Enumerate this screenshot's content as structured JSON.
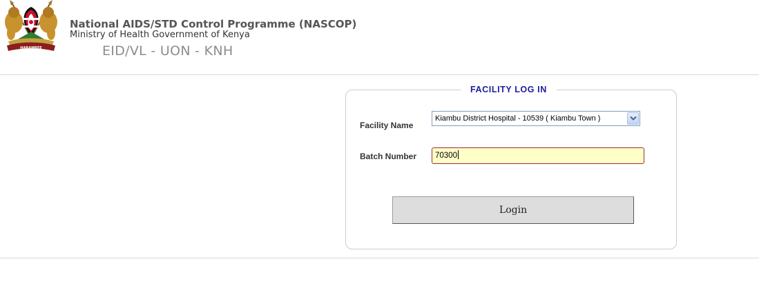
{
  "header": {
    "org_name": "National AIDS/STD Control Programme (NASCOP)",
    "ministry": "Ministry of Health Government of Kenya",
    "subsystem": "EID/VL - UON - KNH"
  },
  "login_form": {
    "legend": "FACILITY LOG IN",
    "facility_label": "Facility Name",
    "facility_selected": "Kiambu District Hospital - 10539 ( Kiambu Town )",
    "batch_label": "Batch Number",
    "batch_value": "70300",
    "login_button": "Login"
  },
  "colors": {
    "legend": "#1b1b9e",
    "batch_input_bg": "#ffffc8",
    "batch_input_border": "#a42a2a",
    "button_bg": "#dddddd"
  }
}
